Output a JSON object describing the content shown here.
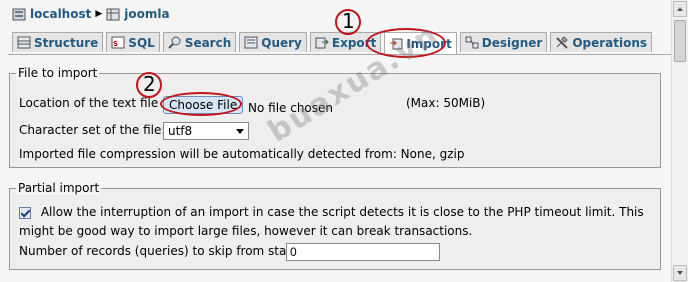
{
  "breadcrumb": {
    "server": "localhost",
    "database": "joomla"
  },
  "tabs": [
    {
      "label": "Structure",
      "icon": "structure-icon"
    },
    {
      "label": "SQL",
      "icon": "sql-icon"
    },
    {
      "label": "Search",
      "icon": "search-icon"
    },
    {
      "label": "Query",
      "icon": "query-icon"
    },
    {
      "label": "Export",
      "icon": "export-icon"
    },
    {
      "label": "Import",
      "icon": "import-icon",
      "active": true
    },
    {
      "label": "Designer",
      "icon": "designer-icon"
    },
    {
      "label": "Operations",
      "icon": "operations-icon"
    }
  ],
  "file_import": {
    "legend": "File to import",
    "location_label": "Location of the text file",
    "choose_button": "Choose File",
    "no_file": "No chosen file",
    "max_size": "(Max: 50MiB)",
    "charset_label": "Character set of the file:",
    "charset_value": "utf8",
    "compression_note": "Imported file compression will be automatically detected from: None, gzip"
  },
  "partial_import": {
    "legend": "Partial import",
    "allow_interrupt_checked": true,
    "allow_interrupt_text_1": "Allow the interruption of an import in case the script detects it is close to the PHP timeout limit. This",
    "allow_interrupt_text_2": "might be good way to import large files, however it can break transactions.",
    "skip_label": "Number of records (queries) to skip from start",
    "skip_value": "0"
  },
  "annotations": {
    "marker_1": "1",
    "marker_2": "2",
    "color": "#c0151b"
  },
  "watermark": "buaxua.vn"
}
